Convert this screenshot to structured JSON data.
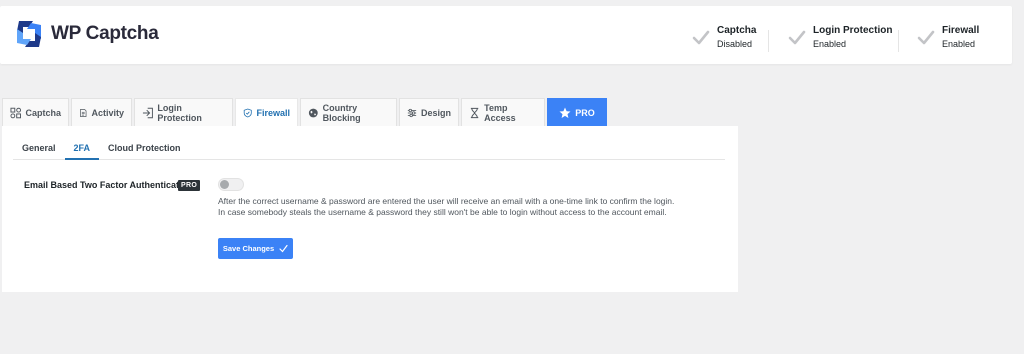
{
  "header": {
    "logo_text": "WP Captcha",
    "statuses": [
      {
        "title": "Captcha",
        "value": "Disabled"
      },
      {
        "title": "Login Protection",
        "value": "Enabled"
      },
      {
        "title": "Firewall",
        "value": "Enabled"
      }
    ]
  },
  "tabs": [
    {
      "label": "Captcha",
      "icon": "captcha-icon"
    },
    {
      "label": "Activity",
      "icon": "document-icon"
    },
    {
      "label": "Login Protection",
      "icon": "login-icon"
    },
    {
      "label": "Firewall",
      "icon": "shield-icon",
      "active": true
    },
    {
      "label": "Country Blocking",
      "icon": "globe-icon"
    },
    {
      "label": "Design",
      "icon": "sliders-icon"
    },
    {
      "label": "Temp Access",
      "icon": "hourglass-icon"
    },
    {
      "label": "PRO",
      "icon": "star-icon"
    }
  ],
  "subtabs": [
    {
      "label": "General"
    },
    {
      "label": "2FA",
      "active": true
    },
    {
      "label": "Cloud Protection"
    }
  ],
  "settings": {
    "email_2fa_label": "Email Based Two Factor Authentication",
    "pro_badge": "PRO",
    "toggle_enabled": false,
    "description_line1": "After the correct username & password are entered the user will receive an email with a one-time link to confirm the login.",
    "description_line2": "In case somebody steals the username & password they still won't be able to login without access to the account email."
  },
  "save_button": {
    "label": "Save Changes"
  },
  "colors": {
    "accent": "#3b82f6",
    "link": "#2271b1",
    "check": "#c3c4c7"
  }
}
